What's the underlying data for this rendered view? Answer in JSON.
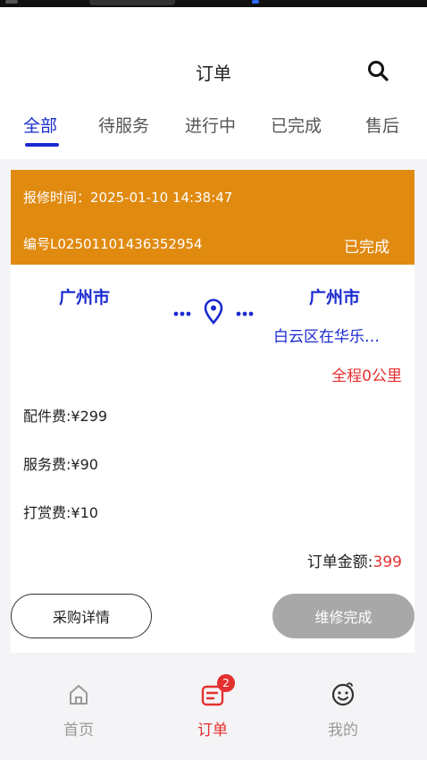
{
  "header": {
    "title": "订单"
  },
  "tabs": [
    "全部",
    "待服务",
    "进行中",
    "已完成",
    "售后"
  ],
  "order": {
    "report_time": "报修时间：2025-01-10 14:38:47",
    "order_no": "编号L02501101436352954",
    "status": "已完成",
    "from_city": "广州市",
    "to_city": "广州市",
    "to_address": "白云区在华乐…",
    "distance": "全程0公里",
    "fees": [
      "配件费:¥299",
      "服务费:¥90",
      "打赏费:¥10"
    ],
    "total_label": "订单金额:",
    "total_amount": "399",
    "detail_button": "采购详情",
    "complete_button": "维修完成"
  },
  "nav": {
    "items": [
      "首页",
      "订单",
      "我的"
    ],
    "order_badge": "2"
  },
  "colors": {
    "accent": "#1a2ad0",
    "header_orange": "#e08a10",
    "red": "#e53030",
    "disabled": "#a8a8a8"
  }
}
